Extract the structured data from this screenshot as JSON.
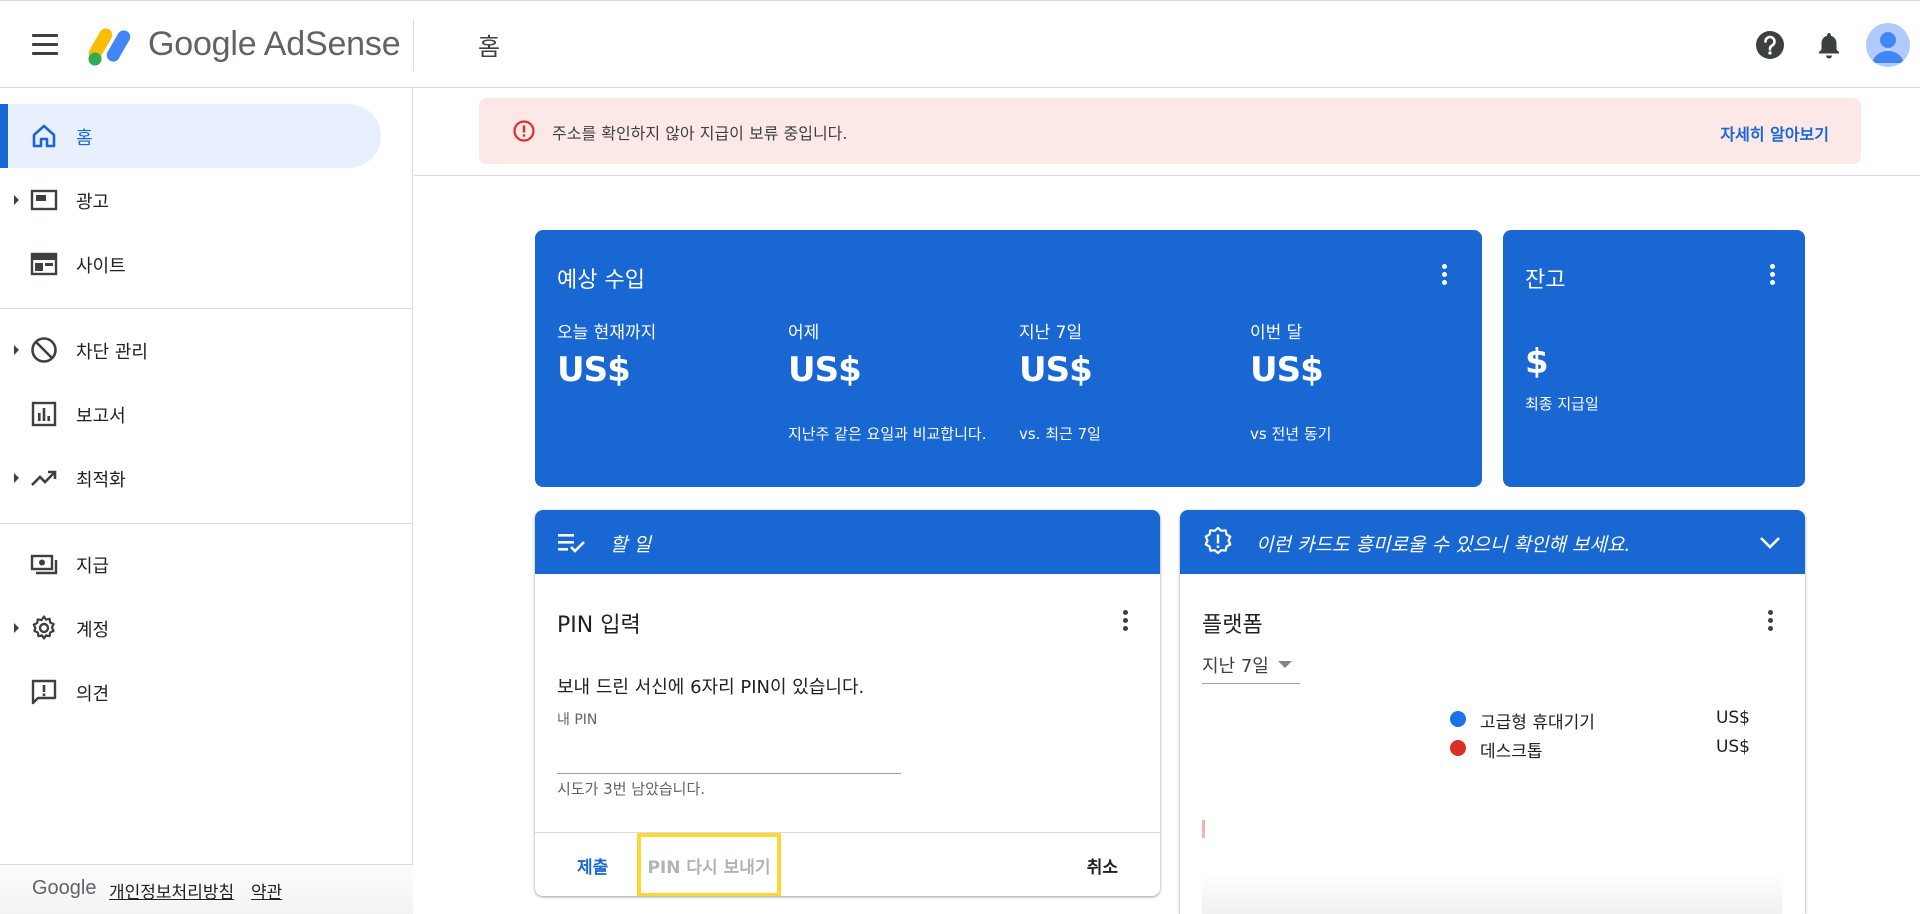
{
  "header": {
    "logo_text": "Google AdSense",
    "page_title": "홈"
  },
  "sidebar": {
    "items": [
      {
        "label": "홈",
        "icon": "home-icon",
        "active": true
      },
      {
        "label": "광고",
        "icon": "ads-icon",
        "expandable": true
      },
      {
        "label": "사이트",
        "icon": "sites-icon"
      },
      {
        "label": "차단 관리",
        "icon": "block-icon",
        "expandable": true
      },
      {
        "label": "보고서",
        "icon": "reports-icon"
      },
      {
        "label": "최적화",
        "icon": "trending-icon",
        "expandable": true
      },
      {
        "label": "지급",
        "icon": "payments-icon"
      },
      {
        "label": "계정",
        "icon": "gear-icon",
        "expandable": true
      },
      {
        "label": "의견",
        "icon": "feedback-icon"
      }
    ],
    "footer": {
      "brand": "Google",
      "privacy": "개인정보처리방침",
      "terms": "약관"
    }
  },
  "alert": {
    "text": "주소를 확인하지 않아 지급이 보류 중입니다.",
    "link": "자세히 알아보기"
  },
  "earnings": {
    "title": "예상 수입",
    "metrics": [
      {
        "label": "오늘 현재까지",
        "value": "US$",
        "sub": ""
      },
      {
        "label": "어제",
        "value": "US$",
        "sub": "지난주 같은 요일과 비교합니다."
      },
      {
        "label": "지난 7일",
        "value": "US$",
        "sub": "vs. 최근 7일"
      },
      {
        "label": "이번 달",
        "value": "US$",
        "sub": "vs 전년 동기"
      }
    ]
  },
  "balance": {
    "title": "잔고",
    "value": "$",
    "sub": "최종 지급일"
  },
  "todo": {
    "header": "할 일",
    "title": "PIN 입력",
    "description": "보내 드린 서신에 6자리 PIN이 있습니다.",
    "field_label": "내 PIN",
    "field_value": "",
    "attempts": "시도가 3번 남았습니다.",
    "submit": "제출",
    "resend": "PIN 다시 보내기",
    "cancel": "취소"
  },
  "suggestion": {
    "header": "이런 카드도 흥미로울 수 있으니 확인해 보세요.",
    "title": "플랫폼",
    "range": "지난 7일",
    "legend": [
      {
        "name": "고급형 휴대기기",
        "value": "US$",
        "color": "#1a73e8"
      },
      {
        "name": "데스크톱",
        "value": "US$",
        "color": "#d93025"
      }
    ]
  },
  "colors": {
    "brand_blue": "#1967d2",
    "alert_bg": "#fce8e6",
    "highlight": "#fdd835"
  }
}
